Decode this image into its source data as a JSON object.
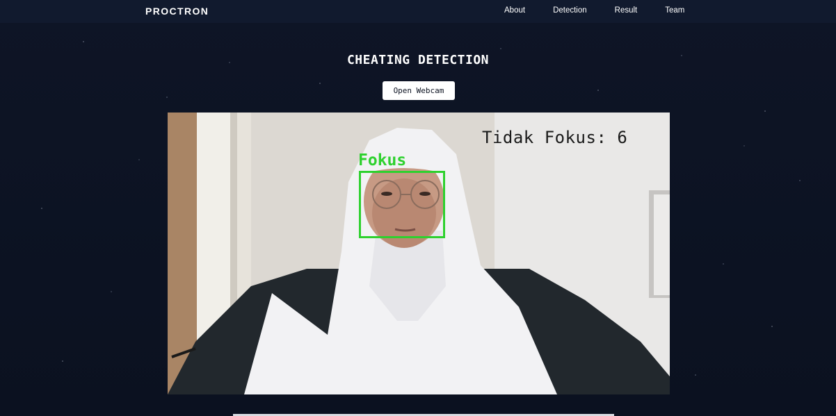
{
  "navbar": {
    "brand": "PROCTRON",
    "links": [
      "About",
      "Detection",
      "Result",
      "Team"
    ]
  },
  "main": {
    "title": "CHEATING DETECTION",
    "webcam_button": "Open Webcam"
  },
  "feed": {
    "tidak_fokus_label": "Tidak Fokus: 6",
    "face_label": "Fokus",
    "box_color": "#2ed12e"
  },
  "colors": {
    "background": "#0c1220",
    "navbar": "#111a2e",
    "text": "#ffffff"
  }
}
